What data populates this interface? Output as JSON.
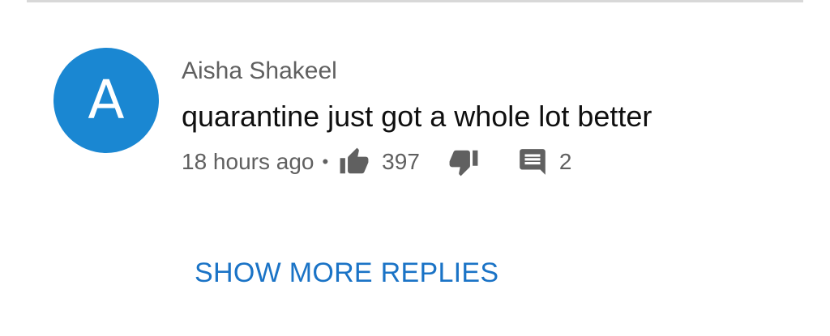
{
  "comment": {
    "avatar_letter": "A",
    "avatar_color": "#1a87d2",
    "author": "Aisha Shakeel",
    "text": "quarantine just got a whole lot better",
    "time": "18 hours ago",
    "separator": "•",
    "like_count": "397",
    "reply_count": "2",
    "icons": {
      "like": "thumbs-up-icon",
      "dislike": "thumbs-down-icon",
      "reply": "comment-icon"
    }
  },
  "replies": {
    "show_more_label": "SHOW MORE REPLIES",
    "link_color": "#1a73c6"
  }
}
